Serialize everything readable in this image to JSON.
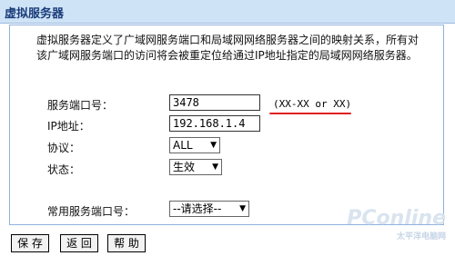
{
  "window": {
    "title": "虚拟服务器"
  },
  "description": "虚拟服务器定义了广域网服务端口和局域网网络服务器之间的映射关系，所有对该广域网服务端口的访问将会被重定位给通过IP地址指定的局域网网络服务器。",
  "form": {
    "service_port": {
      "label": "服务端口号：",
      "value": "3478",
      "hint": "(XX-XX or XX)"
    },
    "ip_address": {
      "label": "IP地址：",
      "value": "192.168.1.4"
    },
    "protocol": {
      "label": "协议：",
      "selected": "ALL"
    },
    "status": {
      "label": "状态：",
      "selected": "生效"
    },
    "common_port": {
      "label": "常用服务端口号：",
      "selected": "--请选择--"
    }
  },
  "buttons": {
    "save": "保 存",
    "back": "返 回",
    "help": "帮 助"
  },
  "watermark": {
    "brand": "PConline",
    "sub": "太平洋电脑网"
  },
  "colors": {
    "hint_underline": "#e02020",
    "title_bg": "#cfe3f7",
    "panel_border": "#8fb2de"
  }
}
